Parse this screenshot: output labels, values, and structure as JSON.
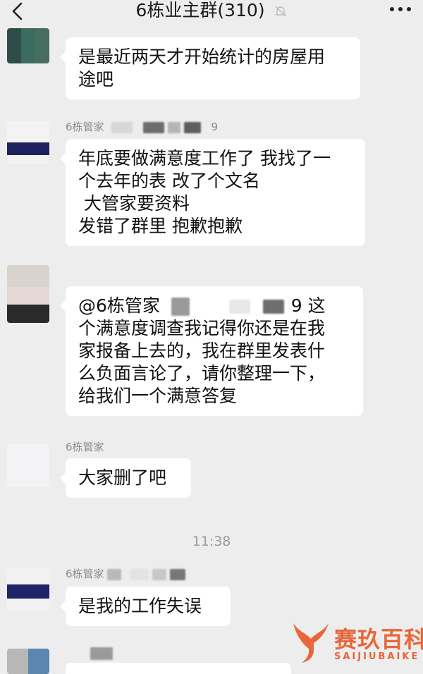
{
  "header": {
    "back_icon": "chevron-left-icon",
    "title": "6栋业主群(310)",
    "mute_icon": "bell-muted-icon",
    "more_icon": "more-dots-icon"
  },
  "messages": [
    {
      "sender": "",
      "lines": [
        "是最近两天才开始统计的房屋用",
        "途吧"
      ]
    },
    {
      "sender": "6栋管家",
      "sender_suffix": "9",
      "lines": [
        "年底要做满意度工作了 我找了一",
        "个去年的表 改了个文名",
        " 大管家要资料",
        "发错了群里 抱歉抱歉"
      ]
    },
    {
      "sender": "",
      "lines": [
        "@6栋管家",
        "个满意度调查我记得你还是在我",
        "家报备上去的，我在群里发表什",
        "么负面言论了，请你整理一下，",
        "给我们一个满意答复"
      ],
      "mention_suffix": "9 这"
    },
    {
      "sender": "6栋管家",
      "lines": [
        "大家删了吧"
      ]
    },
    {
      "sender": "6栋管家",
      "lines": [
        "是我的工作失误"
      ]
    }
  ],
  "timestamp": "11:38",
  "watermark": {
    "cn": "赛玖百科",
    "en": "SAIJIUBAIKE"
  },
  "colors": {
    "background": "#ededed",
    "bubble": "#ffffff",
    "watermark": "#e8663a"
  }
}
